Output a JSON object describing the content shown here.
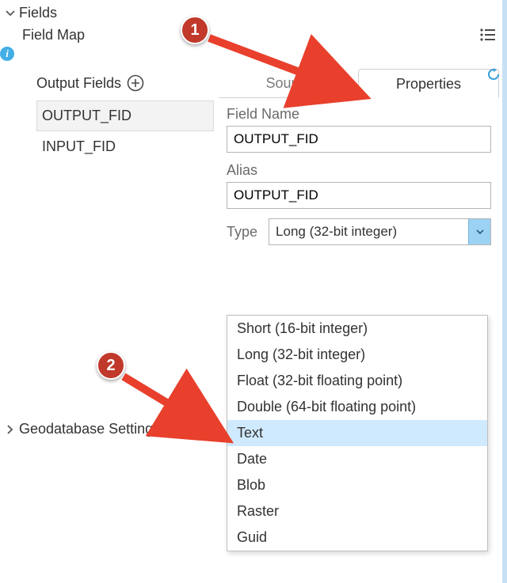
{
  "sections": {
    "fields_title": "Fields",
    "geodb_title": "Geodatabase Settings"
  },
  "fieldmap": {
    "label": "Field Map",
    "output_fields_label": "Output Fields",
    "items": [
      "OUTPUT_FID",
      "INPUT_FID"
    ],
    "selected_index": 0
  },
  "tabs": {
    "source": "Source",
    "properties": "Properties"
  },
  "properties": {
    "field_name_label": "Field Name",
    "field_name_value": "OUTPUT_FID",
    "alias_label": "Alias",
    "alias_value": "OUTPUT_FID",
    "type_label": "Type",
    "type_value": "Long (32-bit integer)"
  },
  "type_options": [
    "Short (16-bit integer)",
    "Long (32-bit integer)",
    "Float (32-bit floating point)",
    "Double (64-bit floating point)",
    "Text",
    "Date",
    "Blob",
    "Raster",
    "Guid"
  ],
  "type_highlight_index": 4,
  "annotations": {
    "badge1": "1",
    "badge2": "2"
  },
  "colors": {
    "accent": "#43aee6",
    "arrow": "#e8402c",
    "badge": "#c0392b",
    "highlight": "#cfeafe"
  }
}
